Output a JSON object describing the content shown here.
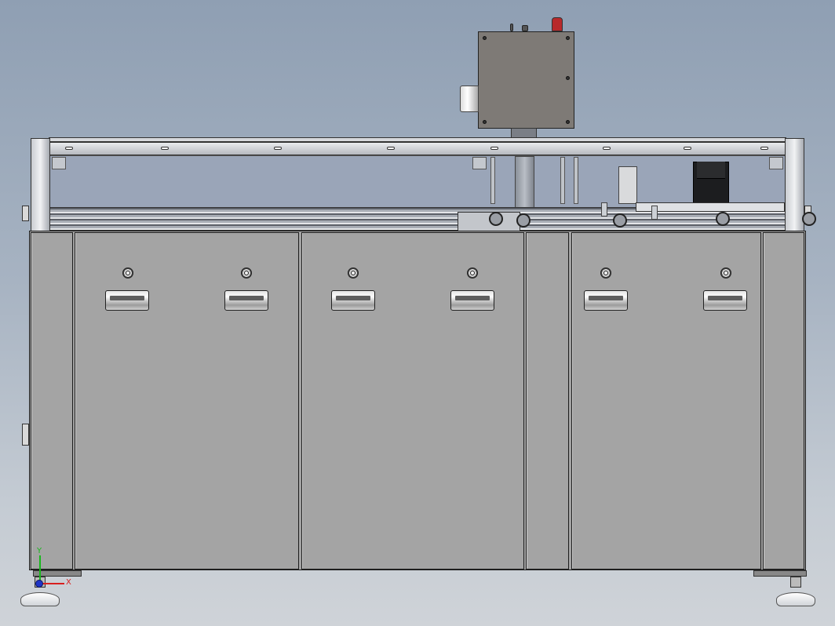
{
  "model": {
    "view": "front",
    "colors": {
      "background_top": "#8f9fb3",
      "background_bottom": "#cfd3d8",
      "cabinet": "#a2a2a2",
      "control_box": "#7e7a76",
      "emergency_stop": "#b8292b",
      "motor": "#1c1d1f"
    },
    "parts": {
      "control_box": "control-box",
      "emergency_stop": "emergency-stop-button",
      "motor": "servo-motor",
      "conveyor": "conveyor-belt",
      "cabinet_doors": 3,
      "door_handles": 6
    }
  },
  "triad": {
    "x_label": "X",
    "y_label": "Y",
    "colors": {
      "x": "#d81f1f",
      "y": "#18b81c",
      "z": "#1f35c8"
    }
  }
}
